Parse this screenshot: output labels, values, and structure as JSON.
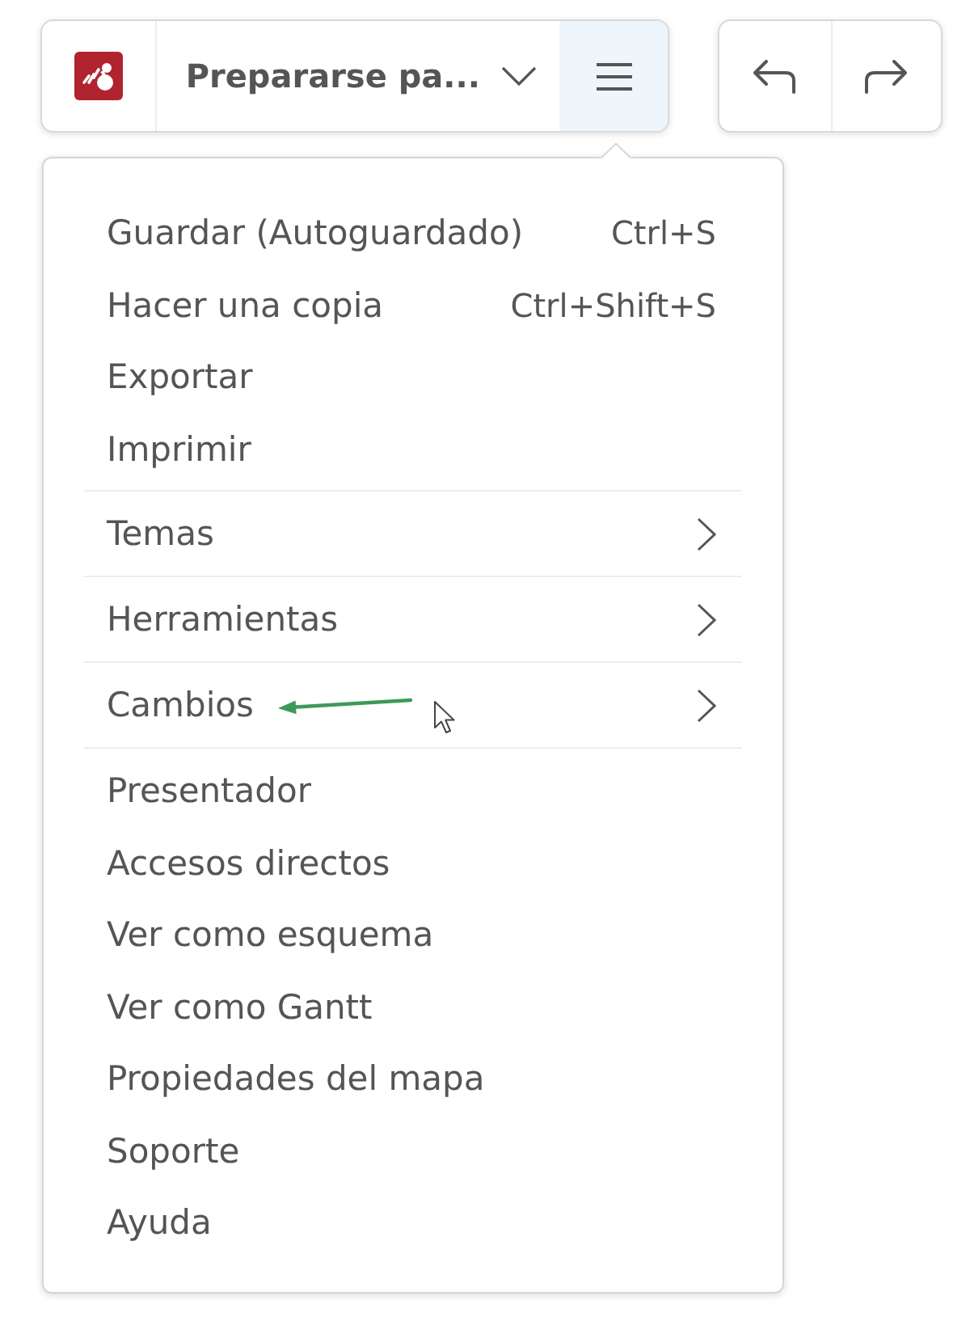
{
  "toolbar": {
    "title": "Prepararse pa...",
    "menu_button": {
      "expanded": true
    }
  },
  "menu": {
    "sections": [
      {
        "items": [
          {
            "kind": "action",
            "label": "Guardar (Autoguardado)",
            "shortcut": "Ctrl+S",
            "annotated": false
          },
          {
            "kind": "action",
            "label": "Hacer una copia",
            "shortcut": "Ctrl+Shift+S",
            "annotated": false
          },
          {
            "kind": "action",
            "label": "Exportar",
            "annotated": false
          },
          {
            "kind": "action",
            "label": "Imprimir",
            "annotated": false
          }
        ]
      },
      {
        "items": [
          {
            "kind": "submenu",
            "label": "Temas",
            "annotated": false
          }
        ]
      },
      {
        "items": [
          {
            "kind": "submenu",
            "label": "Herramientas",
            "annotated": false
          }
        ]
      },
      {
        "items": [
          {
            "kind": "submenu",
            "label": "Cambios",
            "annotated": true
          }
        ]
      },
      {
        "items": [
          {
            "kind": "action",
            "label": "Presentador",
            "annotated": false
          },
          {
            "kind": "action",
            "label": "Accesos directos",
            "annotated": false
          },
          {
            "kind": "action",
            "label": "Ver como esquema",
            "annotated": false
          },
          {
            "kind": "action",
            "label": "Ver como Gantt",
            "annotated": false
          },
          {
            "kind": "action",
            "label": "Propiedades del mapa",
            "annotated": false
          },
          {
            "kind": "action",
            "label": "Soporte",
            "annotated": false
          },
          {
            "kind": "action",
            "label": "Ayuda",
            "annotated": false
          }
        ]
      }
    ]
  }
}
